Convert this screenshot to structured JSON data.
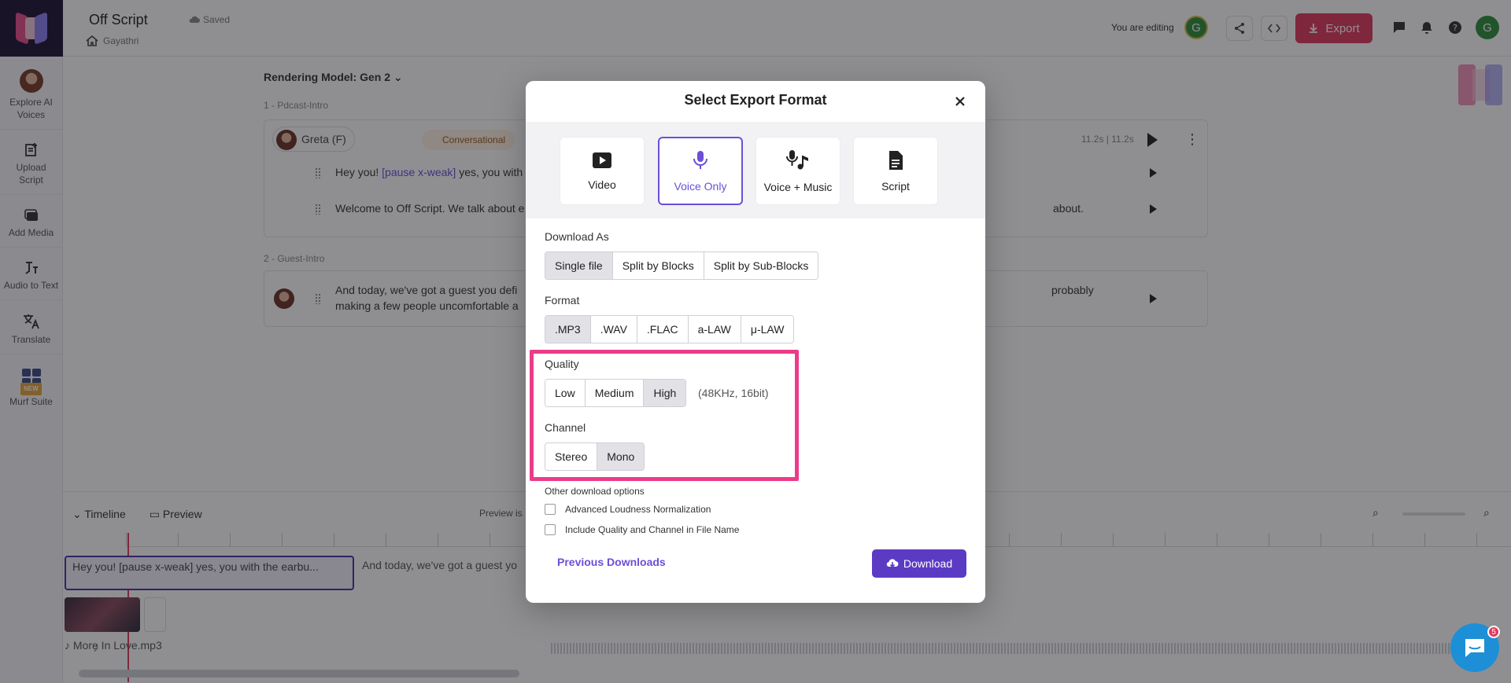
{
  "header": {
    "title": "Off Script",
    "saved": "Saved",
    "owner": "Gayathri",
    "editing_label": "You are editing",
    "avatar_letter": "G",
    "export_label": "Export"
  },
  "sidebar": {
    "items": [
      {
        "label": "Explore AI Voices"
      },
      {
        "label": "Upload Script"
      },
      {
        "label": "Add Media"
      },
      {
        "label": "Audio to Text"
      },
      {
        "label": "Translate"
      },
      {
        "label": "Murf Suite",
        "badge": "NEW"
      }
    ]
  },
  "editor": {
    "rendering_model": "Rendering Model: Gen 2",
    "blocks": [
      {
        "label": "1 -  Pdcast-Intro",
        "voice": "Greta (F)",
        "style": "Conversational",
        "duration": "11.2s | 11.2s",
        "lines": [
          {
            "pre": "Hey you! ",
            "tag": "[pause x-weak]",
            "post": " yes, you with"
          },
          {
            "pre": "Welcome to Off Script. We talk about e",
            "tag": "",
            "post": ""
          }
        ],
        "tail_text": "about."
      },
      {
        "label": "2 -  Guest-Intro",
        "lines": [
          {
            "text": "And today, we've got a guest you defi"
          },
          {
            "text": "making a few people uncomfortable a"
          }
        ],
        "tail_text": "probably"
      }
    ]
  },
  "timeline": {
    "timeline_label": "Timeline",
    "preview_label": "Preview",
    "preview_is": "Preview is",
    "clip1": "Hey you! [pause x-weak] yes, you with the earbu...",
    "clip2": "And today, we've got a guest yo",
    "music_file": "More In Love.mp3"
  },
  "modal": {
    "title": "Select Export Format",
    "tiles": [
      {
        "label": "Video",
        "icon": "video-play-icon"
      },
      {
        "label": "Voice Only",
        "icon": "microphone-icon",
        "selected": true
      },
      {
        "label": "Voice + Music",
        "icon": "mic-music-icon"
      },
      {
        "label": "Script",
        "icon": "document-icon"
      }
    ],
    "download_as": {
      "label": "Download As",
      "options": [
        "Single file",
        "Split by Blocks",
        "Split by Sub-Blocks"
      ],
      "selected": "Single file"
    },
    "format": {
      "label": "Format",
      "options": [
        ".MP3",
        ".WAV",
        ".FLAC",
        "a-LAW",
        "μ-LAW"
      ],
      "selected": ".MP3"
    },
    "quality": {
      "label": "Quality",
      "options": [
        "Low",
        "Medium",
        "High"
      ],
      "selected": "High",
      "note": "(48KHz, 16bit)"
    },
    "channel": {
      "label": "Channel",
      "options": [
        "Stereo",
        "Mono"
      ],
      "selected": "Mono"
    },
    "other": {
      "label": "Other download options",
      "checks": [
        "Advanced Loudness Normalization",
        "Include Quality and Channel in File Name"
      ]
    },
    "previous_downloads": "Previous Downloads",
    "download_label": "Download"
  },
  "chat": {
    "badge": "5"
  },
  "colors": {
    "accent": "#5b3bc4",
    "highlight": "#ec3b8a",
    "export": "#e0385a"
  }
}
